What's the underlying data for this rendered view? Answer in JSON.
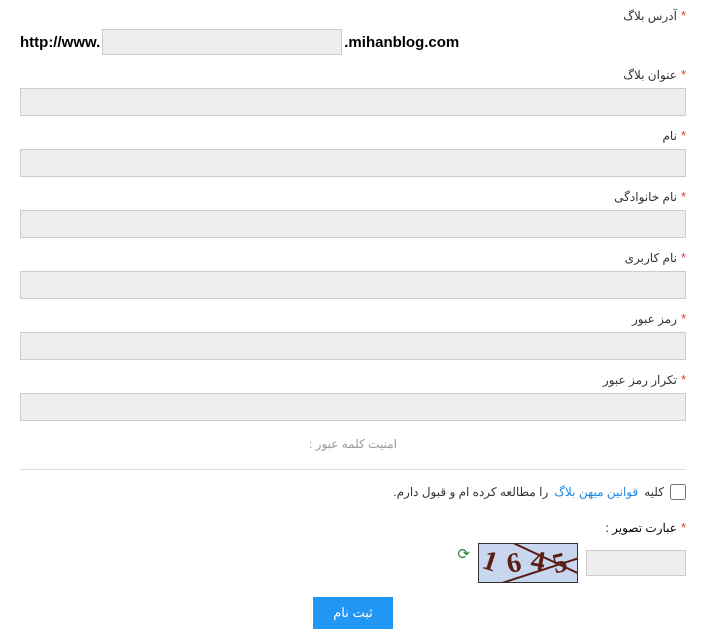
{
  "fields": {
    "blog_address": {
      "label": "آدرس بلاگ"
    },
    "blog_title": {
      "label": "عنوان بلاگ"
    },
    "first_name": {
      "label": "نام"
    },
    "last_name": {
      "label": "نام خانوادگی"
    },
    "username": {
      "label": "نام کاربری"
    },
    "password": {
      "label": "رمز عبور"
    },
    "password_confirm": {
      "label": "تکرار رمز عبور"
    }
  },
  "url": {
    "prefix": "http://www.",
    "suffix": ".mihanblog.com"
  },
  "hint": "امنیت کلمه عبور :",
  "terms": {
    "pre": "کلیه",
    "link": "قوانین میهن بلاگ",
    "post": "را مطالعه کرده ام و قبول دارم."
  },
  "captcha": {
    "label": "عبارت تصویر :",
    "chars": [
      "1",
      "6",
      "4",
      "5"
    ]
  },
  "submit": "ثبت نام",
  "required_mark": "*"
}
